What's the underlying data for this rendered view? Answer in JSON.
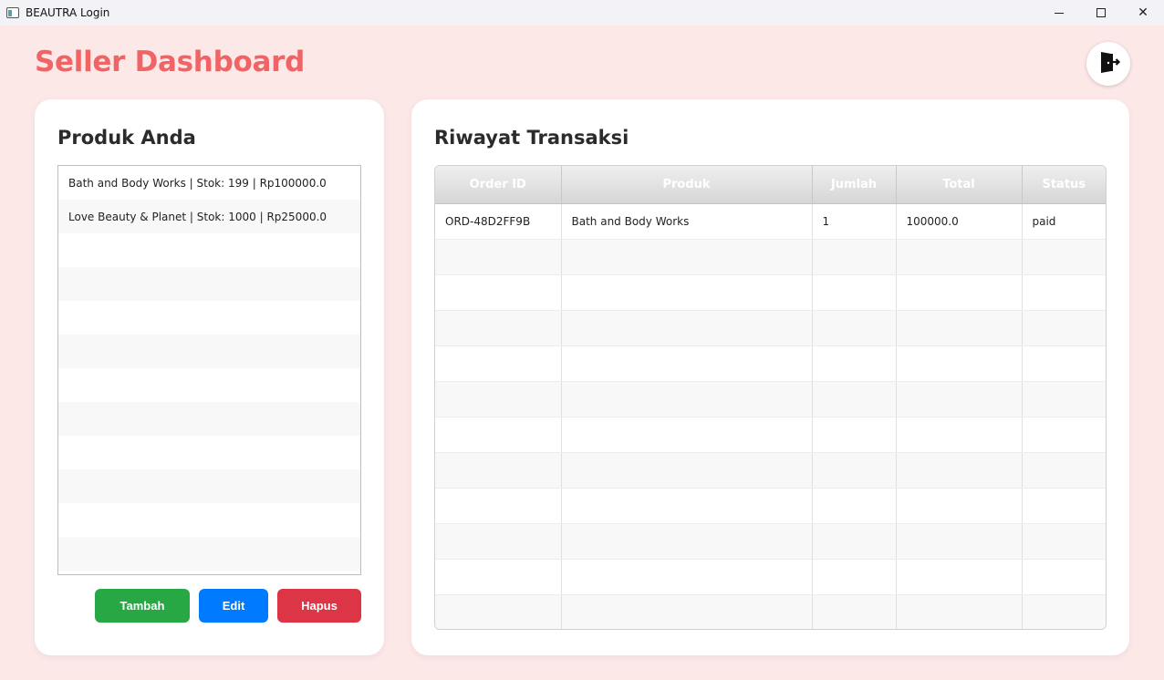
{
  "window": {
    "title": "BEAUTRA Login",
    "controls": {
      "minimize": "minimize-icon",
      "maximize": "maximize-icon",
      "close": "✕"
    }
  },
  "header": {
    "title": "Seller Dashboard",
    "title_color": "#f06466",
    "logout_icon": "logout-door-icon"
  },
  "products": {
    "title": "Produk Anda",
    "items": [
      "Bath and Body Works | Stok: 199 | Rp100000.0",
      "Love Beauty & Planet | Stok: 1000 | Rp25000.0"
    ],
    "buttons": {
      "add": "Tambah",
      "edit": "Edit",
      "delete": "Hapus"
    },
    "button_colors": {
      "add": "#28a745",
      "edit": "#007bff",
      "delete": "#dc3545"
    }
  },
  "transactions": {
    "title": "Riwayat Transaksi",
    "columns": [
      "Order ID",
      "Produk",
      "Jumlah",
      "Total",
      "Status"
    ],
    "rows": [
      [
        "ORD-48D2FF9B",
        "Bath and Body Works",
        "1",
        "100000.0",
        "paid"
      ]
    ]
  }
}
